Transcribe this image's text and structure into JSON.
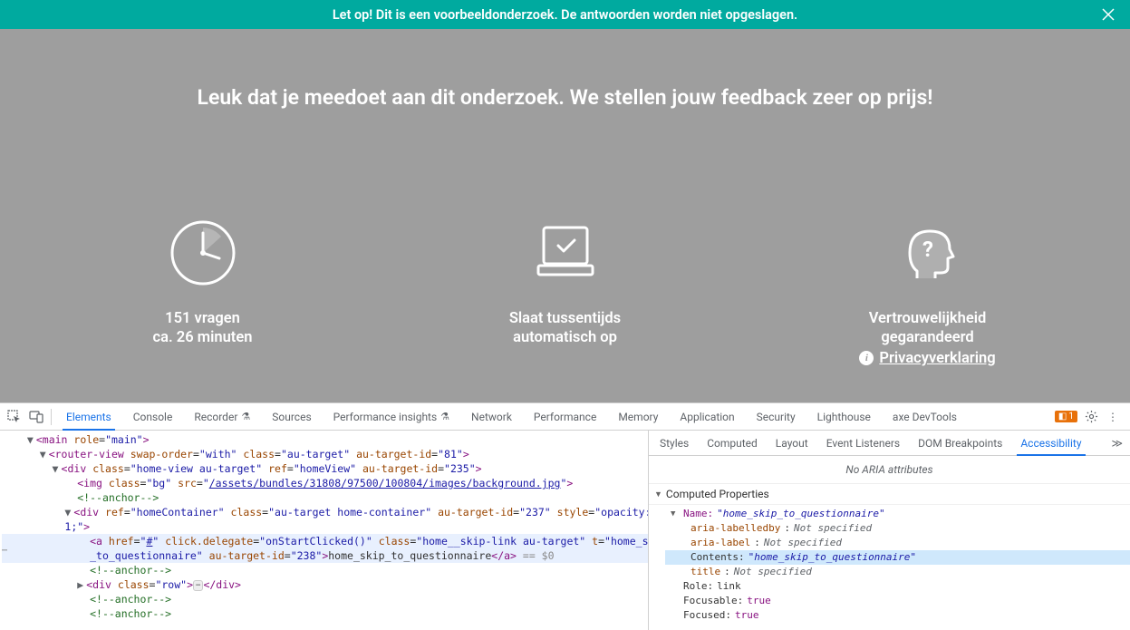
{
  "banner": {
    "text": "Let op! Dit is een voorbeeldonderzoek. De antwoorden worden niet opgeslagen."
  },
  "intro": "Leuk dat je meedoet aan dit onderzoek. We stellen jouw feedback zeer op prijs!",
  "info": {
    "questions": {
      "line1": "151 vragen",
      "line2": "ca. 26 minuten"
    },
    "autosave": {
      "line1": "Slaat tussentijds",
      "line2": "automatisch op"
    },
    "privacy": {
      "line1": "Vertrouwelijkheid",
      "line2": "gegarandeerd",
      "link": "Privacyverklaring"
    }
  },
  "devtools": {
    "tabs": [
      "Elements",
      "Console",
      "Recorder",
      "Sources",
      "Performance insights",
      "Network",
      "Performance",
      "Memory",
      "Application",
      "Security",
      "Lighthouse",
      "axe DevTools"
    ],
    "active_tab": "Elements",
    "issues_count": "1",
    "side_tabs": [
      "Styles",
      "Computed",
      "Layout",
      "Event Listeners",
      "DOM Breakpoints",
      "Accessibility"
    ],
    "active_side_tab": "Accessibility",
    "no_aria": "No ARIA attributes",
    "section": "Computed Properties",
    "props": {
      "name_label": "Name:",
      "name_value": "home_skip_to_questionnaire",
      "aria_labelledby": "aria-labelledby",
      "aria_label": "aria-label",
      "not_specified": "Not specified",
      "contents_label": "Contents:",
      "contents_value": "home_skip_to_questionnaire",
      "title": "title",
      "role_label": "Role:",
      "role_value": "link",
      "focusable_label": "Focusable:",
      "focusable_value": "true",
      "focused_label": "Focused:",
      "focused_value": "true"
    },
    "elements": {
      "img_src": "/assets/bundles/31808/97500/100804/images/background.jpg",
      "skip_text": "home_skip_to_questionnaire",
      "sel_hint": " == $0"
    }
  }
}
